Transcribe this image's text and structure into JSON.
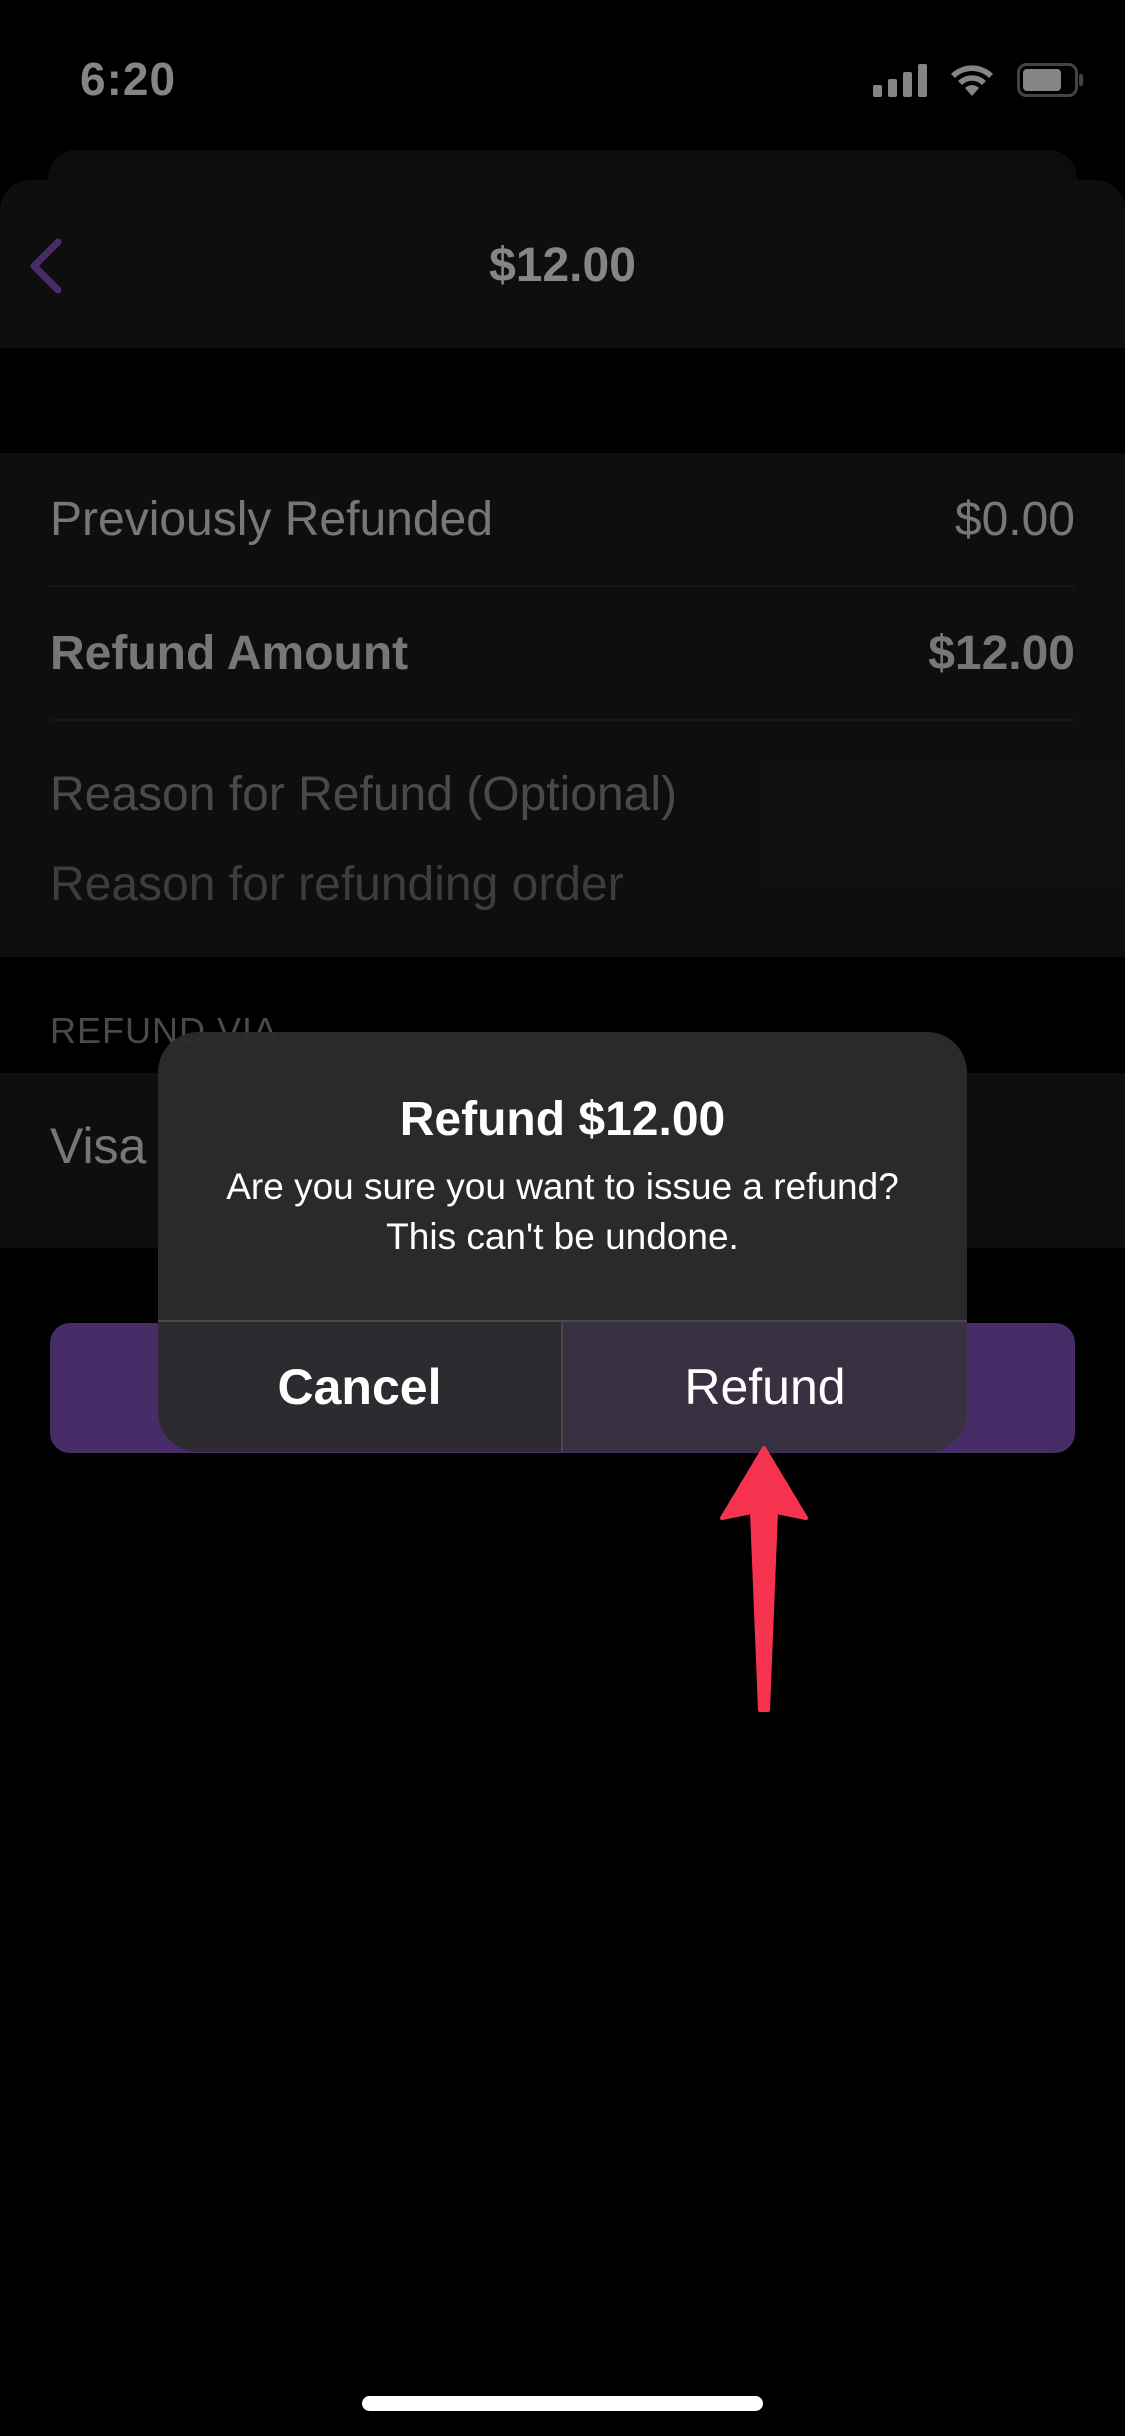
{
  "status_bar": {
    "time": "6:20",
    "icons": [
      "cellular-signal-icon",
      "wifi-icon",
      "battery-icon"
    ]
  },
  "nav": {
    "title": "$12.00",
    "back_icon": "chevron-left-icon"
  },
  "refund_details": {
    "previously_refunded_label": "Previously Refunded",
    "previously_refunded_value": "$0.00",
    "refund_amount_label": "Refund Amount",
    "refund_amount_value": "$12.00",
    "reason_label": "Reason for Refund (Optional)",
    "reason_placeholder": "Reason for refunding order",
    "reason_value": ""
  },
  "refund_via": {
    "section_header": "REFUND VIA",
    "method": "Visa"
  },
  "alert": {
    "title": "Refund $12.00",
    "message": "Are you sure you want to issue a refund? This can't be undone.",
    "cancel_label": "Cancel",
    "confirm_label": "Refund"
  },
  "colors": {
    "accent": "#8a55c8",
    "annotation_arrow": "#f5334f"
  }
}
